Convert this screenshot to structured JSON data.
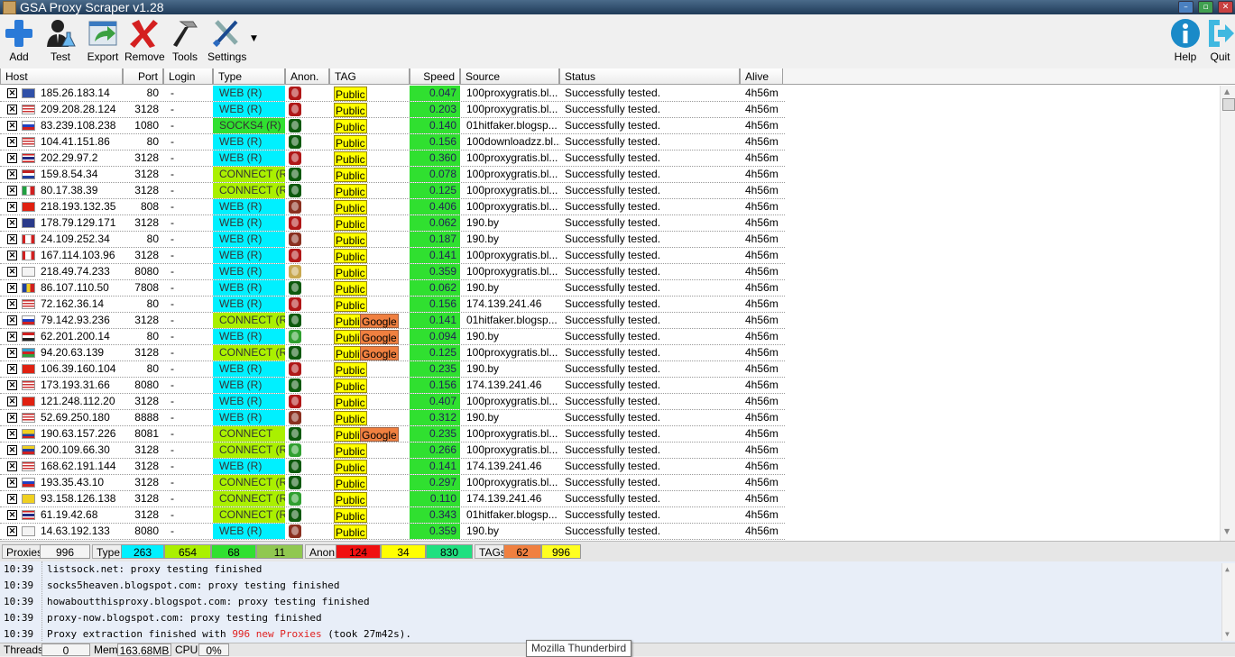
{
  "window": {
    "title": "GSA Proxy Scraper v1.28"
  },
  "toolbar": {
    "add": "Add",
    "test": "Test",
    "export": "Export",
    "remove": "Remove",
    "tools": "Tools",
    "settings": "Settings",
    "help": "Help",
    "quit": "Quit"
  },
  "columns": {
    "host": "Host",
    "port": "Port",
    "login": "Login",
    "type": "Type",
    "anon": "Anon.",
    "tag": "TAG",
    "speed": "Speed",
    "source": "Source",
    "status": "Status",
    "alive": "Alive"
  },
  "colors": {
    "web": "#00f0ff",
    "connect": "#aaf000",
    "socks": "#30e030",
    "speed": "#30e030",
    "public": "#ffff00",
    "google": "#f08040",
    "anon_red": "#b01818",
    "anon_green": "#0d5a0d",
    "anon_spy_brown": "#8a3020",
    "anon_spy_green": "#30a030",
    "anon_spy_tan": "#c8a850"
  },
  "rows": [
    {
      "flag": "eu",
      "host": "185.26.183.14",
      "port": "80",
      "login": "-",
      "type": "WEB (R)",
      "tcls": "web",
      "anon": "red",
      "tags": [
        "Public"
      ],
      "speed": "0.047",
      "source": "100proxygratis.bl...",
      "status": "Successfully tested.",
      "alive": "4h56m"
    },
    {
      "flag": "us",
      "host": "209.208.28.124",
      "port": "3128",
      "login": "-",
      "type": "WEB (R)",
      "tcls": "web",
      "anon": "red",
      "tags": [
        "Public"
      ],
      "speed": "0.203",
      "source": "100proxygratis.bl...",
      "status": "Successfully tested.",
      "alive": "4h56m"
    },
    {
      "flag": "ru",
      "host": "83.239.108.238",
      "port": "1080",
      "login": "-",
      "type": "SOCKS4 (R)",
      "tcls": "socks",
      "anon": "green",
      "tags": [
        "Public"
      ],
      "speed": "0.140",
      "source": "01hitfaker.blogsp...",
      "status": "Successfully tested.",
      "alive": "4h56m"
    },
    {
      "flag": "us",
      "host": "104.41.151.86",
      "port": "80",
      "login": "-",
      "type": "WEB (R)",
      "tcls": "web",
      "anon": "green",
      "tags": [
        "Public"
      ],
      "speed": "0.156",
      "source": "100downloadzz.bl...",
      "status": "Successfully tested.",
      "alive": "4h56m"
    },
    {
      "flag": "th",
      "host": "202.29.97.2",
      "port": "3128",
      "login": "-",
      "type": "WEB (R)",
      "tcls": "web",
      "anon": "red",
      "tags": [
        "Public"
      ],
      "speed": "0.360",
      "source": "100proxygratis.bl...",
      "status": "Successfully tested.",
      "alive": "4h56m"
    },
    {
      "flag": "nl",
      "host": "159.8.54.34",
      "port": "3128",
      "login": "-",
      "type": "CONNECT (R)",
      "tcls": "connect",
      "anon": "green",
      "tags": [
        "Public"
      ],
      "speed": "0.078",
      "source": "100proxygratis.bl...",
      "status": "Successfully tested.",
      "alive": "4h56m"
    },
    {
      "flag": "it",
      "host": "80.17.38.39",
      "port": "3128",
      "login": "-",
      "type": "CONNECT (R)",
      "tcls": "connect",
      "anon": "green",
      "tags": [
        "Public"
      ],
      "speed": "0.125",
      "source": "100proxygratis.bl...",
      "status": "Successfully tested.",
      "alive": "4h56m"
    },
    {
      "flag": "cn",
      "host": "218.193.132.35",
      "port": "808",
      "login": "-",
      "type": "WEB (R)",
      "tcls": "web",
      "anon": "spy-brown",
      "tags": [
        "Public"
      ],
      "speed": "0.406",
      "source": "100proxygratis.bl...",
      "status": "Successfully tested.",
      "alive": "4h56m"
    },
    {
      "flag": "gb",
      "host": "178.79.129.171",
      "port": "3128",
      "login": "-",
      "type": "WEB (R)",
      "tcls": "web",
      "anon": "red",
      "tags": [
        "Public"
      ],
      "speed": "0.062",
      "source": "190.by",
      "status": "Successfully tested.",
      "alive": "4h56m"
    },
    {
      "flag": "ca",
      "host": "24.109.252.34",
      "port": "80",
      "login": "-",
      "type": "WEB (R)",
      "tcls": "web",
      "anon": "spy-brown",
      "tags": [
        "Public"
      ],
      "speed": "0.187",
      "source": "190.by",
      "status": "Successfully tested.",
      "alive": "4h56m"
    },
    {
      "flag": "ca",
      "host": "167.114.103.96",
      "port": "3128",
      "login": "-",
      "type": "WEB (R)",
      "tcls": "web",
      "anon": "red",
      "tags": [
        "Public"
      ],
      "speed": "0.141",
      "source": "100proxygratis.bl...",
      "status": "Successfully tested.",
      "alive": "4h56m"
    },
    {
      "flag": "kr",
      "host": "218.49.74.233",
      "port": "8080",
      "login": "-",
      "type": "WEB (R)",
      "tcls": "web",
      "anon": "spy-tan",
      "tags": [
        "Public"
      ],
      "speed": "0.359",
      "source": "100proxygratis.bl...",
      "status": "Successfully tested.",
      "alive": "4h56m"
    },
    {
      "flag": "ro",
      "host": "86.107.110.50",
      "port": "7808",
      "login": "-",
      "type": "WEB (R)",
      "tcls": "web",
      "anon": "green",
      "tags": [
        "Public"
      ],
      "speed": "0.062",
      "source": "190.by",
      "status": "Successfully tested.",
      "alive": "4h56m"
    },
    {
      "flag": "us",
      "host": "72.162.36.14",
      "port": "80",
      "login": "-",
      "type": "WEB (R)",
      "tcls": "web",
      "anon": "red",
      "tags": [
        "Public"
      ],
      "speed": "0.156",
      "source": "174.139.241.46",
      "status": "Successfully tested.",
      "alive": "4h56m"
    },
    {
      "flag": "ru",
      "host": "79.142.93.236",
      "port": "3128",
      "login": "-",
      "type": "CONNECT (R)",
      "tcls": "connect",
      "anon": "green",
      "tags": [
        "Public",
        "Google"
      ],
      "speed": "0.141",
      "source": "01hitfaker.blogsp...",
      "status": "Successfully tested.",
      "alive": "4h56m"
    },
    {
      "flag": "eg",
      "host": "62.201.200.14",
      "port": "80",
      "login": "-",
      "type": "WEB (R)",
      "tcls": "web",
      "anon": "spy-green",
      "tags": [
        "Public",
        "Google"
      ],
      "speed": "0.094",
      "source": "190.by",
      "status": "Successfully tested.",
      "alive": "4h56m"
    },
    {
      "flag": "az",
      "host": "94.20.63.139",
      "port": "3128",
      "login": "-",
      "type": "CONNECT (R)",
      "tcls": "connect",
      "anon": "green",
      "tags": [
        "Public",
        "Google"
      ],
      "speed": "0.125",
      "source": "100proxygratis.bl...",
      "status": "Successfully tested.",
      "alive": "4h56m"
    },
    {
      "flag": "cn",
      "host": "106.39.160.104",
      "port": "80",
      "login": "-",
      "type": "WEB (R)",
      "tcls": "web",
      "anon": "red",
      "tags": [
        "Public"
      ],
      "speed": "0.235",
      "source": "190.by",
      "status": "Successfully tested.",
      "alive": "4h56m"
    },
    {
      "flag": "us",
      "host": "173.193.31.66",
      "port": "8080",
      "login": "-",
      "type": "WEB (R)",
      "tcls": "web",
      "anon": "green",
      "tags": [
        "Public"
      ],
      "speed": "0.156",
      "source": "174.139.241.46",
      "status": "Successfully tested.",
      "alive": "4h56m"
    },
    {
      "flag": "cn",
      "host": "121.248.112.20",
      "port": "3128",
      "login": "-",
      "type": "WEB (R)",
      "tcls": "web",
      "anon": "red",
      "tags": [
        "Public"
      ],
      "speed": "0.407",
      "source": "100proxygratis.bl...",
      "status": "Successfully tested.",
      "alive": "4h56m"
    },
    {
      "flag": "us",
      "host": "52.69.250.180",
      "port": "8888",
      "login": "-",
      "type": "WEB (R)",
      "tcls": "web",
      "anon": "spy-brown",
      "tags": [
        "Public"
      ],
      "speed": "0.312",
      "source": "190.by",
      "status": "Successfully tested.",
      "alive": "4h56m"
    },
    {
      "flag": "co",
      "host": "190.63.157.226",
      "port": "8081",
      "login": "-",
      "type": "CONNECT",
      "tcls": "connect",
      "anon": "green",
      "tags": [
        "Public",
        "Google"
      ],
      "speed": "0.235",
      "source": "100proxygratis.bl...",
      "status": "Successfully tested.",
      "alive": "4h56m"
    },
    {
      "flag": "ve",
      "host": "200.109.66.30",
      "port": "3128",
      "login": "-",
      "type": "CONNECT (R)",
      "tcls": "connect",
      "anon": "spy-green",
      "tags": [
        "Public"
      ],
      "speed": "0.266",
      "source": "100proxygratis.bl...",
      "status": "Successfully tested.",
      "alive": "4h56m"
    },
    {
      "flag": "us",
      "host": "168.62.191.144",
      "port": "3128",
      "login": "-",
      "type": "WEB (R)",
      "tcls": "web",
      "anon": "green",
      "tags": [
        "Public"
      ],
      "speed": "0.141",
      "source": "174.139.241.46",
      "status": "Successfully tested.",
      "alive": "4h56m"
    },
    {
      "flag": "ru",
      "host": "193.35.43.10",
      "port": "3128",
      "login": "-",
      "type": "CONNECT (R)",
      "tcls": "connect",
      "anon": "green",
      "tags": [
        "Public"
      ],
      "speed": "0.297",
      "source": "100proxygratis.bl...",
      "status": "Successfully tested.",
      "alive": "4h56m"
    },
    {
      "flag": "se",
      "host": "93.158.126.138",
      "port": "3128",
      "login": "-",
      "type": "CONNECT (R)",
      "tcls": "connect",
      "anon": "spy-green",
      "tags": [
        "Public"
      ],
      "speed": "0.110",
      "source": "174.139.241.46",
      "status": "Successfully tested.",
      "alive": "4h56m"
    },
    {
      "flag": "th",
      "host": "61.19.42.68",
      "port": "3128",
      "login": "-",
      "type": "CONNECT (R)",
      "tcls": "connect",
      "anon": "green",
      "tags": [
        "Public"
      ],
      "speed": "0.343",
      "source": "01hitfaker.blogsp...",
      "status": "Successfully tested.",
      "alive": "4h56m"
    },
    {
      "flag": "kr",
      "host": "14.63.192.133",
      "port": "8080",
      "login": "-",
      "type": "WEB (R)",
      "tcls": "web",
      "anon": "spy-brown",
      "tags": [
        "Public"
      ],
      "speed": "0.359",
      "source": "190.by",
      "status": "Successfully tested.",
      "alive": "4h56m"
    }
  ],
  "stats": {
    "proxies_label": "Proxies",
    "proxies": "996",
    "type_label": "Type",
    "type_web": "263",
    "type_connect": "654",
    "type_socks": "68",
    "type_other": "11",
    "anon_label": "Anon.",
    "anon_transparent": "124",
    "anon_anonymous": "34",
    "anon_elite": "830",
    "tags_label": "TAGs",
    "tags_google": "62",
    "tags_public": "996"
  },
  "log": [
    {
      "time": "10:39",
      "msg": "listsock.net: proxy testing finished"
    },
    {
      "time": "10:39",
      "msg": "socks5heaven.blogspot.com: proxy testing finished"
    },
    {
      "time": "10:39",
      "msg": "howaboutthisproxy.blogspot.com: proxy testing finished"
    },
    {
      "time": "10:39",
      "msg": "proxy-now.blogspot.com: proxy testing finished"
    },
    {
      "time": "10:39",
      "msg_pre": "Proxy extraction finished with ",
      "msg_hl": "996 new Proxies",
      "msg_post": " (took 27m42s)."
    }
  ],
  "bottom": {
    "threads_label": "Threads",
    "threads": "0",
    "mem_label": "Mem",
    "mem": "163.68MB",
    "cpu_label": "CPU",
    "cpu": "0%"
  },
  "tooltip": "Mozilla Thunderbird"
}
